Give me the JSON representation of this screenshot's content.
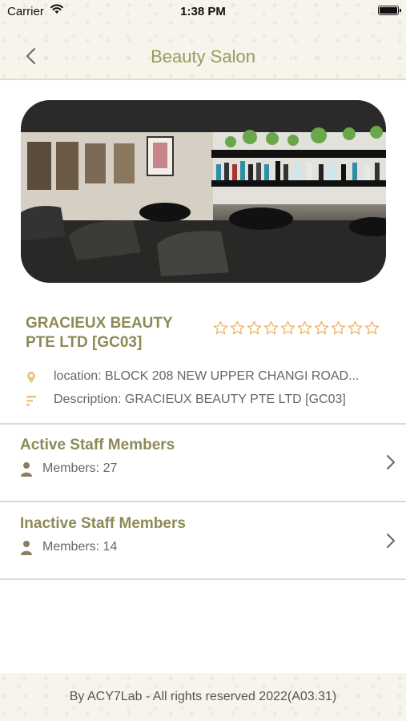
{
  "status_bar": {
    "carrier": "Carrier",
    "time": "1:38 PM"
  },
  "header": {
    "title": "Beauty Salon"
  },
  "salon": {
    "name_line1": "GRACIEUX BEAUTY",
    "name_line2": "PTE LTD [GC03]",
    "rating": 0,
    "max_rating": 10,
    "location": "location: BLOCK 208 NEW UPPER CHANGI ROAD...",
    "description": "Description: GRACIEUX BEAUTY PTE LTD [GC03]"
  },
  "sections": [
    {
      "title": "Active Staff Members",
      "members": "Members: 27"
    },
    {
      "title": "Inactive Staff Members",
      "members": "Members: 14"
    }
  ],
  "footer": {
    "text": "By ACY7Lab - All rights reserved 2022(A03.31)"
  },
  "colors": {
    "accent": "#8c8a55",
    "title": "#9c9a5e",
    "star": "#e9b25c",
    "icon": "#e9c77b",
    "member_icon": "#8a8060"
  },
  "icons": [
    "wifi-icon",
    "battery-icon",
    "back-chevron-icon",
    "star-icon",
    "location-pin-icon",
    "description-lines-icon",
    "person-icon",
    "chevron-right-icon"
  ]
}
